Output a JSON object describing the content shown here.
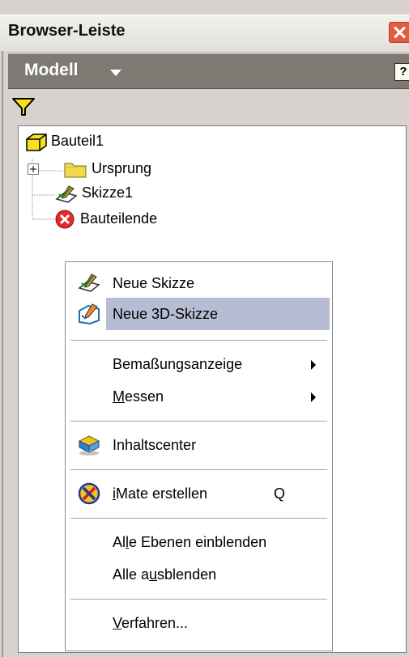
{
  "window": {
    "title": "Browser-Leiste"
  },
  "toolbar": {
    "model_label": "Modell",
    "help_label": "?"
  },
  "tree": {
    "root": "Bauteil1",
    "items": [
      {
        "label": "Ursprung",
        "icon": "folder-icon"
      },
      {
        "label": "Skizze1",
        "icon": "sketch-icon"
      },
      {
        "label": "Bauteilende",
        "icon": "part-end-icon"
      }
    ]
  },
  "context_menu": {
    "items": [
      {
        "label": "Neue Skizze",
        "icon": "sketch-icon"
      },
      {
        "label": "Neue 3D-Skizze",
        "icon": "sketch-3d-icon",
        "highlighted": true
      },
      {
        "label": "Bemaßungsanzeige",
        "submenu": true
      },
      {
        "label_pre": "",
        "label_u": "M",
        "label_post": "essen",
        "submenu": true
      },
      {
        "label": "Inhaltscenter",
        "icon": "content-center-icon"
      },
      {
        "label_pre": "",
        "label_u": "i",
        "label_post": "Mate erstellen",
        "shortcut": "Q",
        "icon": "imate-icon"
      },
      {
        "label_pre": "Al",
        "label_u": "l",
        "label_post": "e Ebenen einblenden"
      },
      {
        "label_pre": "Alle a",
        "label_u": "u",
        "label_post": "sblenden"
      },
      {
        "label_pre": "",
        "label_u": "V",
        "label_post": "erfahren..."
      }
    ]
  },
  "colors": {
    "highlight": "#b6bdd2",
    "header": "#7d7a74",
    "close": "#e25b3e"
  }
}
